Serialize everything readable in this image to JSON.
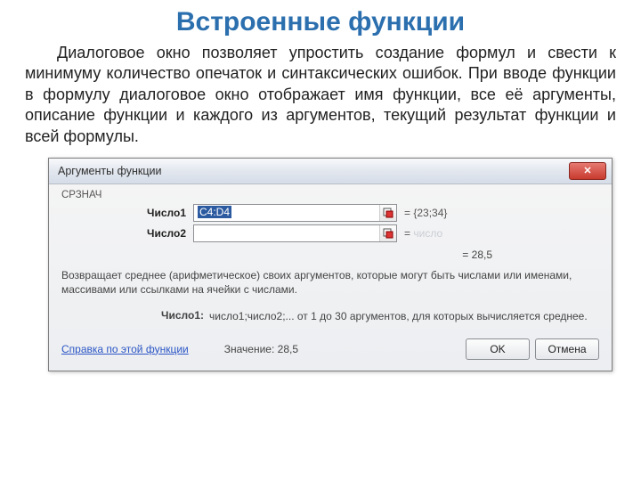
{
  "title": "Встроенные функции",
  "paragraph": "Диалоговое окно позволяет упростить создание формул и свести к минимуму количество опечаток и синтаксических ошибок. При вводе функции в формулу диалоговое окно отображает имя функции, все её аргументы, описание функции и каждого из аргументов, текущий результат функции и всей формулы.",
  "dialog": {
    "title": "Аргументы функции",
    "function_name": "СРЗНАЧ",
    "args": [
      {
        "label": "Число1",
        "value": "C4:D4",
        "evaluation": "= {23;34}",
        "selected": true
      },
      {
        "label": "Число2",
        "value": "",
        "evaluation": "=",
        "ghost": "число"
      }
    ],
    "result_line": "= 28,5",
    "description": "Возвращает среднее (арифметическое) своих аргументов, которые могут быть числами или именами, массивами или ссылками на ячейки с числами.",
    "arg_help_label": "Число1:",
    "arg_help_text": "число1;число2;... от 1 до 30 аргументов, для которых вычисляется среднее.",
    "help_link": "Справка по этой функции",
    "value_label": "Значение:",
    "value": "28,5",
    "ok": "OK",
    "cancel": "Отмена"
  }
}
